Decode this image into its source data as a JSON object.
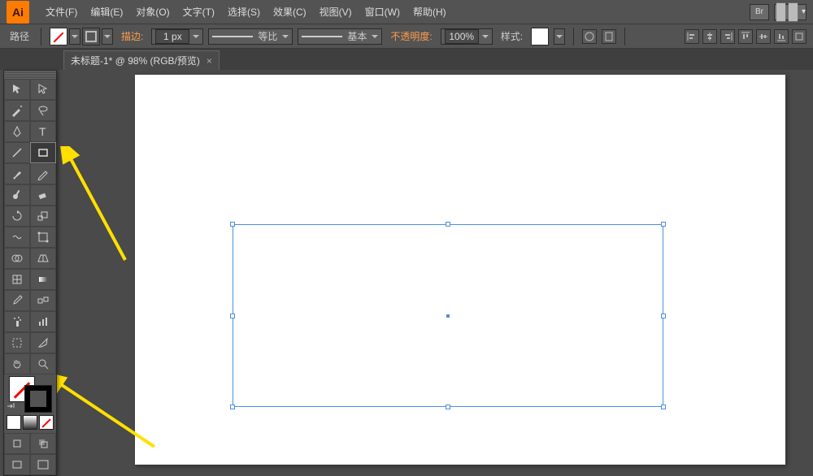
{
  "logo_text": "Ai",
  "menu": [
    "文件(F)",
    "编辑(E)",
    "对象(O)",
    "文字(T)",
    "选择(S)",
    "效果(C)",
    "视图(V)",
    "窗口(W)",
    "帮助(H)"
  ],
  "top_right": {
    "br_label": "Br"
  },
  "options": {
    "path_label": "路径",
    "stroke_label": "描边:",
    "stroke_value": "1 px",
    "profile_label": "等比",
    "brush_label": "基本",
    "opacity_label": "不透明度:",
    "opacity_value": "100%",
    "style_label": "样式:"
  },
  "doc_tab": {
    "title": "未标题-1* @ 98% (RGB/预览)"
  },
  "tools": {
    "left": [
      "selection",
      "pen",
      "brush",
      "line",
      "paintbrush",
      "rotate",
      "scale",
      "width",
      "mesh",
      "eyedropper",
      "column-graph",
      "artboard",
      "hand"
    ],
    "right": [
      "direct-selection",
      "magic-wand",
      "type",
      "rectangle",
      "blob-brush",
      "eraser",
      "free-transform",
      "shape-builder",
      "gradient",
      "blend",
      "symbol-sprayer",
      "slice",
      "zoom"
    ]
  }
}
